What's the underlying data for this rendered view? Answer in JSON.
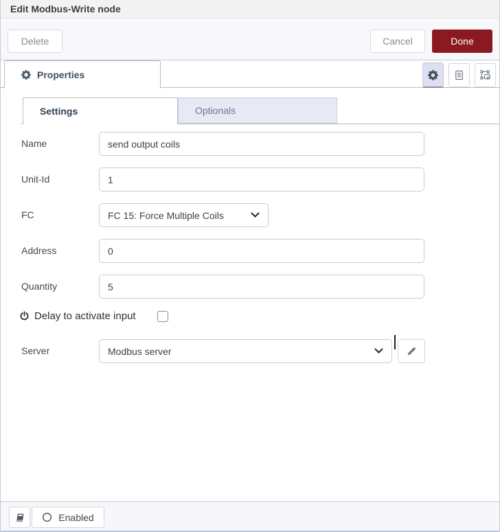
{
  "dialog": {
    "title": "Edit Modbus-Write node",
    "buttons": {
      "delete": "Delete",
      "cancel": "Cancel",
      "done": "Done"
    }
  },
  "tabs": {
    "properties": "Properties"
  },
  "subtabs": {
    "settings": "Settings",
    "optionals": "Optionals"
  },
  "form": {
    "name": {
      "label": "Name",
      "value": "send output coils"
    },
    "unit_id": {
      "label": "Unit-Id",
      "value": "1"
    },
    "fc": {
      "label": "FC",
      "value": "FC 15: Force Multiple Coils"
    },
    "address": {
      "label": "Address",
      "value": "0"
    },
    "quantity": {
      "label": "Quantity",
      "value": "5"
    },
    "delay": {
      "label": "Delay to activate input",
      "checked": false
    },
    "server": {
      "label": "Server",
      "value": "Modbus server"
    }
  },
  "footer": {
    "enabled_label": "Enabled"
  },
  "icons": {
    "properties_tab": "gear-icon",
    "view_buttons": [
      "gear-icon",
      "file-icon",
      "object-group-icon"
    ],
    "delay_row": "power-icon",
    "server_edit": "pencil-icon",
    "selects": "chevron-down-icon",
    "footer": [
      "book-icon",
      "circle-icon"
    ]
  },
  "colors": {
    "done_button_bg": "#8b1a20",
    "header_bg": "#f3f3f3",
    "inactive_tab_bg": "#e7e9f4",
    "active_view_button_bg": "#dde0f0"
  }
}
